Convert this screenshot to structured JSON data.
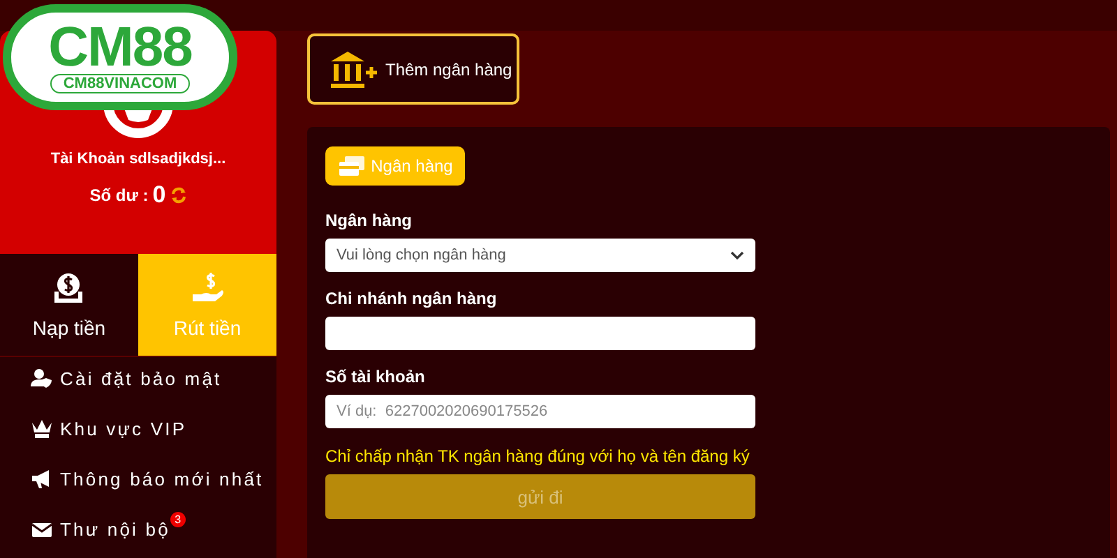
{
  "logo": {
    "title": "CM88",
    "subtitle": "CM88VINACOM"
  },
  "account": {
    "name": "Tài Khoản sdlsadjkdsj...",
    "balance_label": "Số dư :",
    "balance": "0"
  },
  "tabs": [
    {
      "label": "Nạp tiền",
      "kind": "deposit",
      "selected": false
    },
    {
      "label": "Rút tiền",
      "kind": "withdraw",
      "selected": true
    }
  ],
  "menu": [
    {
      "label": "Cài đặt bảo mật",
      "kind": "security"
    },
    {
      "label": "Khu vực VIP",
      "kind": "vip"
    },
    {
      "label": "Thông báo mới nhất",
      "kind": "notice"
    },
    {
      "label": "Thư nội bộ",
      "kind": "mail",
      "badge": "3"
    }
  ],
  "add_bank_button": "Thêm ngân hàng",
  "form": {
    "tab": "Ngân hàng",
    "fields": [
      {
        "label": "Ngân hàng",
        "kind": "select",
        "placeholder": "Vui lòng chọn ngân hàng"
      },
      {
        "label": "Chi nhánh ngân hàng",
        "kind": "text"
      },
      {
        "label": "Số tài khoản",
        "kind": "text",
        "placeholder": "Ví dụ:  6227002020690175526"
      }
    ],
    "note": "Chỉ chấp nhận TK ngân hàng đúng với họ và tên đăng ký",
    "submit": {
      "label": "gửi đi",
      "disabled": true
    }
  }
}
